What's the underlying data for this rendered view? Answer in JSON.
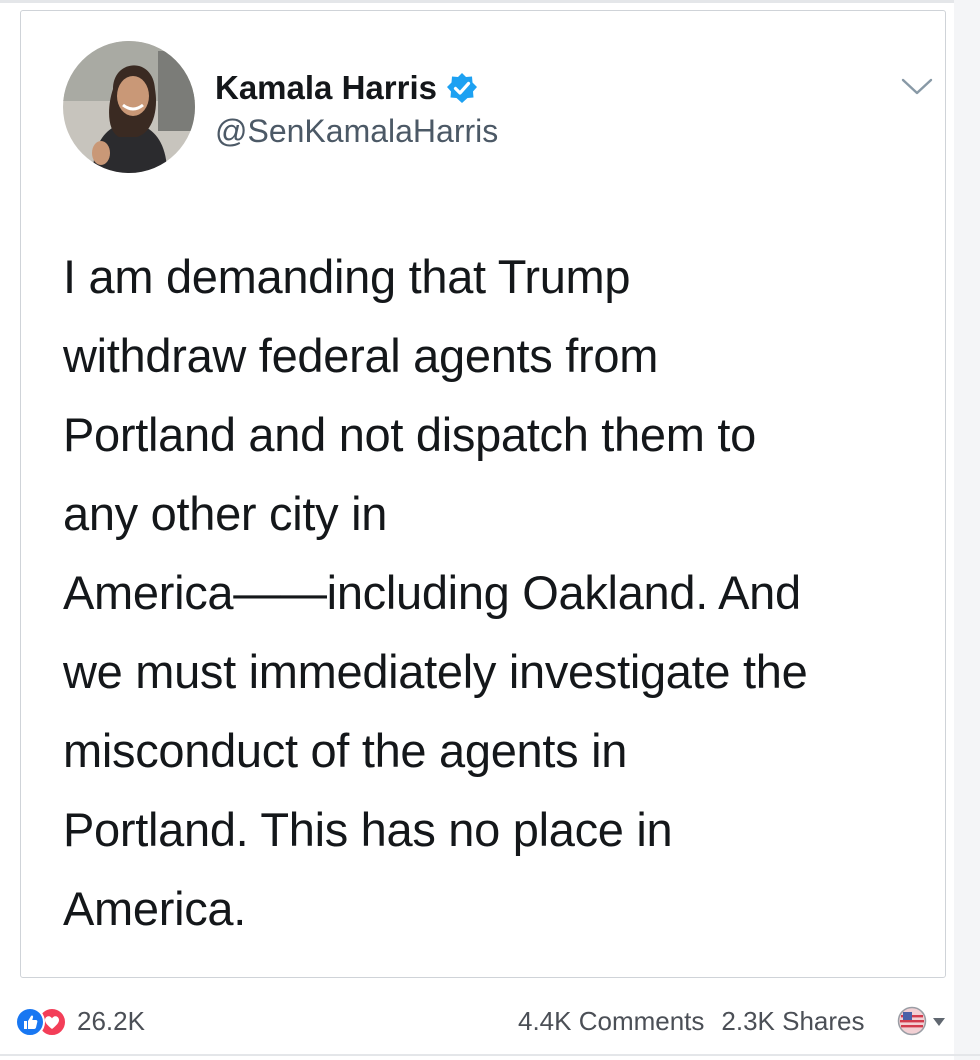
{
  "tweet": {
    "author_name": "Kamala Harris",
    "handle": "@SenKamalaHarris",
    "lines": [
      "I am demanding that Trump",
      "withdraw federal agents from",
      "Portland and not dispatch them to",
      "any other city in",
      "America——including Oakland. And",
      "we must immediately investigate the",
      "misconduct of the agents in",
      "Portland. This has no place in",
      "America."
    ]
  },
  "post": {
    "reactions_count": "26.2K",
    "comments": "4.4K Comments",
    "shares": "2.3K Shares"
  },
  "icons": {
    "verified": "verified-badge-icon",
    "chevron": "chevron-down-icon",
    "like": "like-reaction-icon",
    "love": "love-reaction-icon",
    "reaction_picker": "reaction-flag-icon",
    "dropdown": "caret-down-icon"
  },
  "colors": {
    "verified_blue": "#1da1f2",
    "like_blue": "#1877f2",
    "love_red": "#f33e58"
  }
}
